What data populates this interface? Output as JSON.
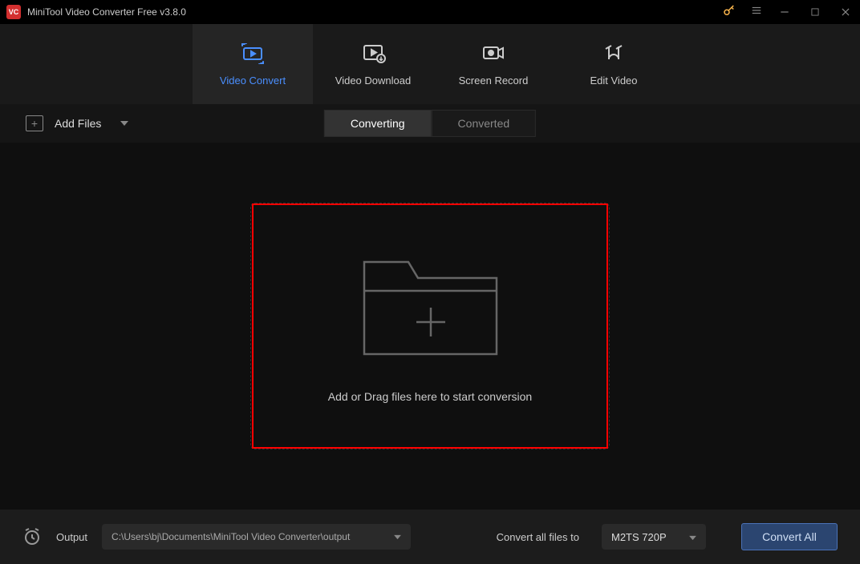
{
  "titlebar": {
    "app_icon_text": "VC",
    "title": "MiniTool Video Converter Free v3.8.0"
  },
  "tabs": [
    {
      "label": "Video Convert",
      "active": true
    },
    {
      "label": "Video Download",
      "active": false
    },
    {
      "label": "Screen Record",
      "active": false
    },
    {
      "label": "Edit Video",
      "active": false
    }
  ],
  "toolbar": {
    "add_files_label": "Add Files",
    "status_tabs": {
      "converting": "Converting",
      "converted": "Converted"
    }
  },
  "dropzone": {
    "text": "Add or Drag files here to start conversion"
  },
  "bottombar": {
    "output_label": "Output",
    "output_path": "C:\\Users\\bj\\Documents\\MiniTool Video Converter\\output",
    "convert_all_label": "Convert all files to",
    "format_selected": "M2TS 720P",
    "convert_all_button": "Convert All"
  }
}
